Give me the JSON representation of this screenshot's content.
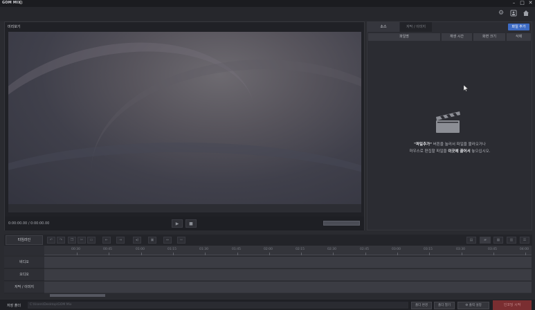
{
  "window": {
    "app_title": "GOM MIX",
    "minimize_glyph": "–",
    "maximize_glyph": "□",
    "close_glyph": "✕"
  },
  "toolbar": {
    "icons": [
      "gear-icon",
      "account-icon",
      "home-icon"
    ]
  },
  "preview": {
    "label": "미리보기",
    "timecode": "0:00:00.00 / 0:00:00.00"
  },
  "source": {
    "tabs": [
      {
        "label": "소스",
        "active": true
      },
      {
        "label": "자막 / 이미지",
        "active": false
      }
    ],
    "add_file_button": "파일 추가",
    "columns": [
      "파일명",
      "재생 시간",
      "화면 크기",
      "삭제"
    ],
    "empty_line1_quoted": "\"파일추가\"",
    "empty_line1_rest": " 버튼을 눌러서 파일을 불러오거나",
    "empty_line2_pre": "마우스로 편집할 파일을 ",
    "empty_line2_bold": "이곳에 끌어서",
    "empty_line2_post": " 놓으십시오."
  },
  "timeline": {
    "timeline_button": "타임라인",
    "ticks": [
      "00:30",
      "00:45",
      "01:00",
      "01:15",
      "01:30",
      "01:45",
      "02:00",
      "02:15",
      "02:30",
      "02:45",
      "03:00",
      "03:15",
      "03:30",
      "03:45",
      "04:00",
      "04:15"
    ],
    "tracks": [
      "비디오",
      "오디오",
      "자막 / 이미지"
    ]
  },
  "bottom": {
    "save_label": "저장 폴더",
    "save_path": "C:\\Users\\Desktop\\GOM Mix",
    "btn_change": "폴더 변경",
    "btn_open": "폴더 열기",
    "btn_settings": "출력 설정",
    "encode_button": "인코딩 시작"
  },
  "colors": {
    "accent": "#3d6bc4",
    "encode": "#7a2e31"
  }
}
